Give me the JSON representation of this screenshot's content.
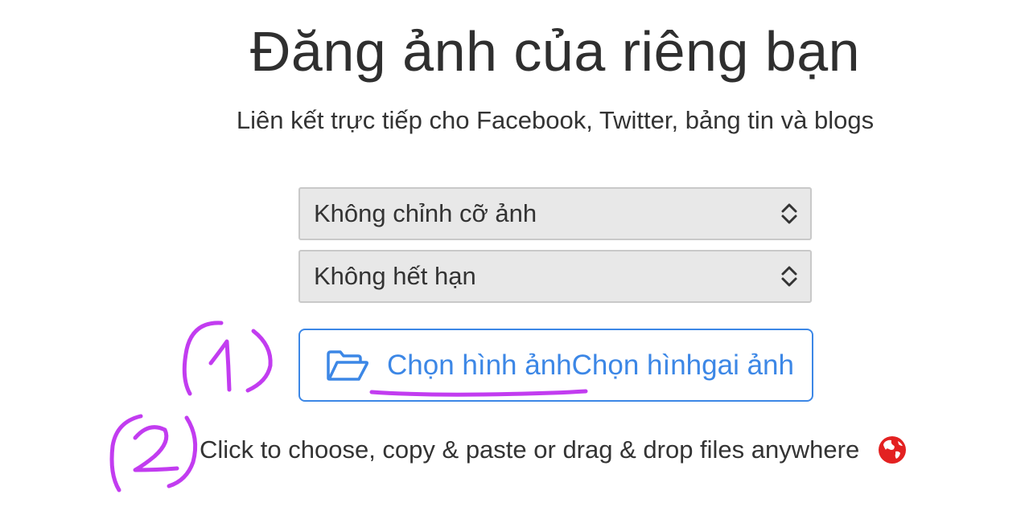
{
  "header": {
    "title": "Đăng ảnh của riêng bạn",
    "subtitle": "Liên kết trực tiếp cho Facebook, Twitter, bảng tin và blogs"
  },
  "options": {
    "resize_select": {
      "selected": "Không chỉnh cỡ ảnh",
      "icon": "chevron-up-down-icon"
    },
    "expire_select": {
      "selected": "Không hết hạn",
      "icon": "chevron-up-down-icon"
    }
  },
  "upload": {
    "button_label": "Chọn hình ảnhChọn hìnhgai ảnh",
    "icon": "folder-open-icon",
    "accent_color": "#3c87e6"
  },
  "hint": {
    "text": "Click to choose, copy & paste or drag & drop files anywhere",
    "icon": "globe-icon"
  },
  "annotations": {
    "marker_1": "(1)",
    "marker_2": "(2)",
    "color": "#c23cf0"
  }
}
